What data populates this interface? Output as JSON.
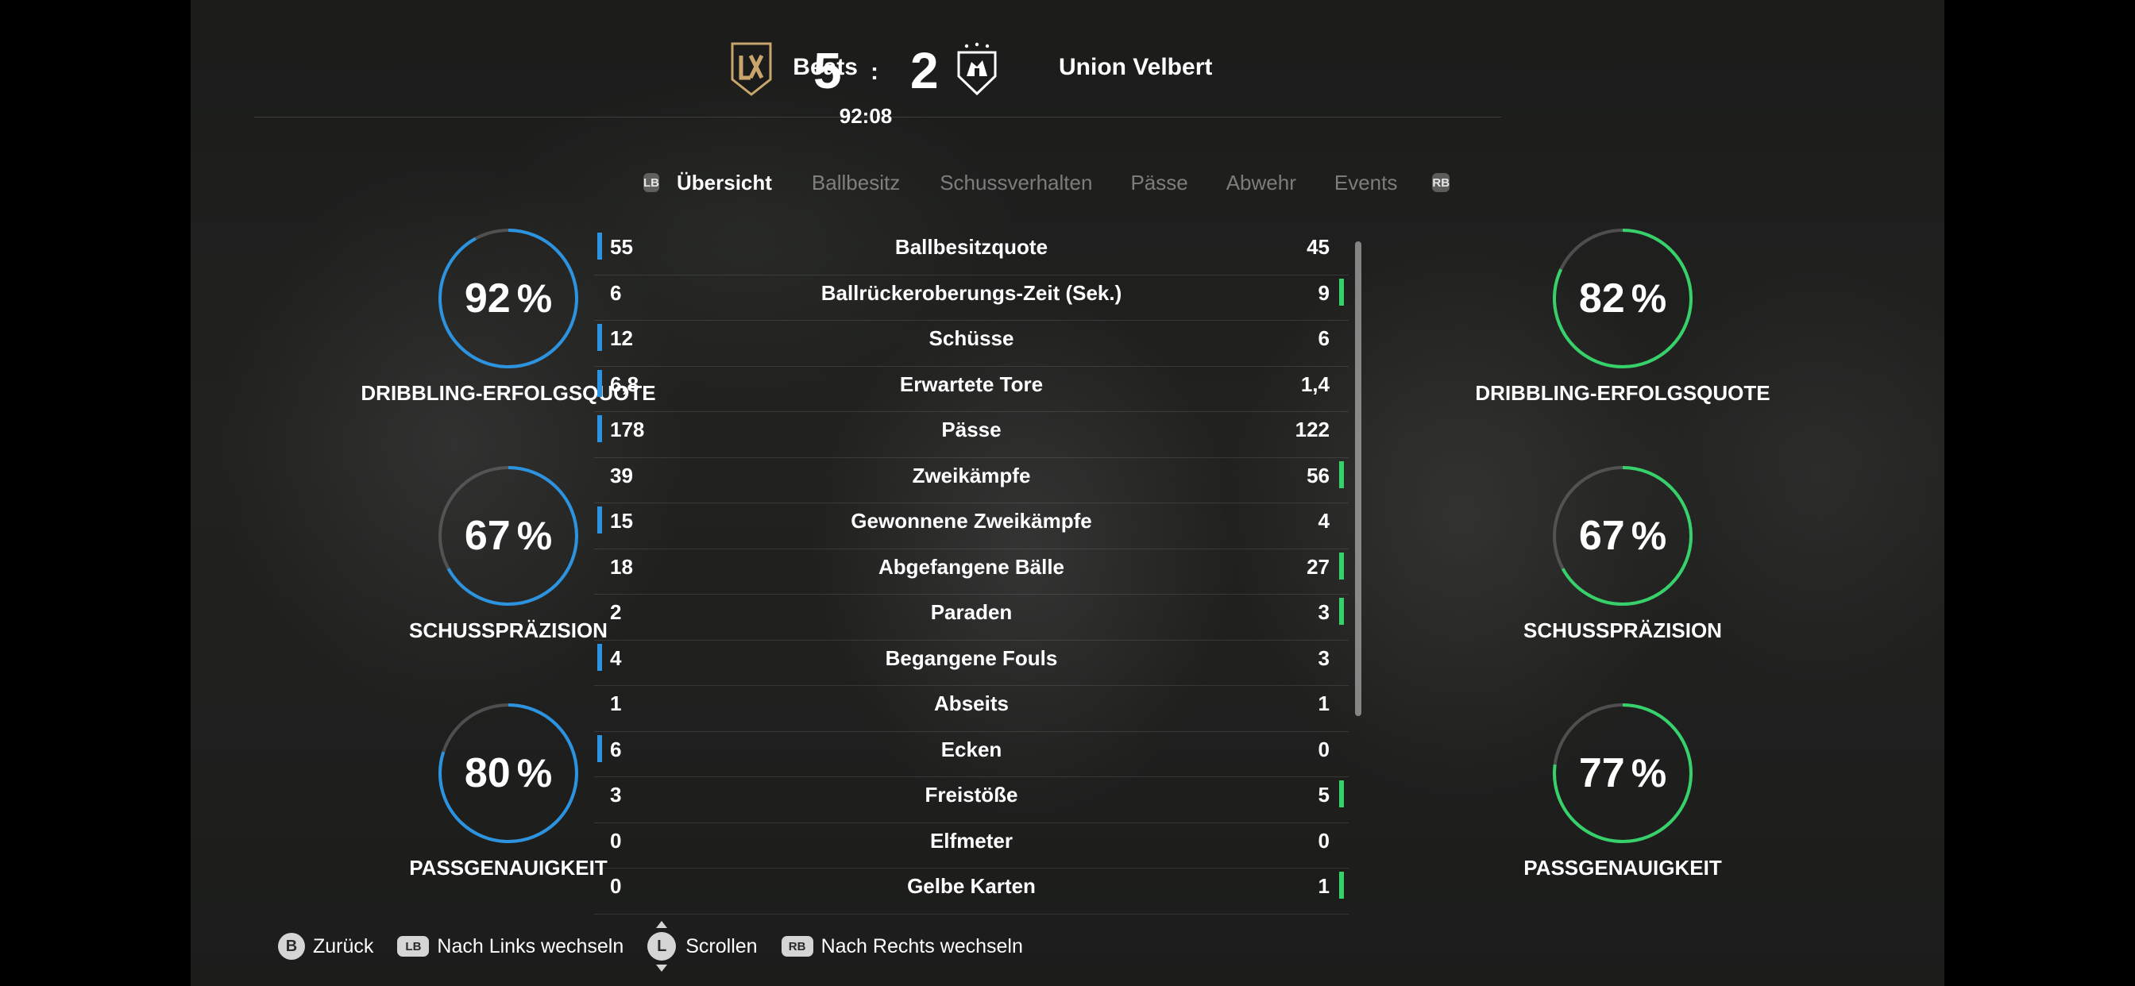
{
  "match": {
    "home_team": "Beats",
    "away_team": "Union Velbert",
    "home_score": "5",
    "score_separator": ":",
    "away_score": "2",
    "clock": "92:08"
  },
  "tabs": {
    "left_shoulder": "LB",
    "right_shoulder": "RB",
    "items": [
      {
        "label": "Übersicht",
        "active": true
      },
      {
        "label": "Ballbesitz",
        "active": false
      },
      {
        "label": "Schussverhalten",
        "active": false
      },
      {
        "label": "Pässe",
        "active": false
      },
      {
        "label": "Abwehr",
        "active": false
      },
      {
        "label": "Events",
        "active": false
      }
    ]
  },
  "home_rings": [
    {
      "value": "92",
      "unit": "%",
      "fraction": 0.92,
      "label": "DRIBBLING-ERFOLGSQUOTE"
    },
    {
      "value": "67",
      "unit": "%",
      "fraction": 0.67,
      "label": "SCHUSSPRÄZISION"
    },
    {
      "value": "80",
      "unit": "%",
      "fraction": 0.8,
      "label": "PASSGENAUIGKEIT"
    }
  ],
  "away_rings": [
    {
      "value": "82",
      "unit": "%",
      "fraction": 0.82,
      "label": "DRIBBLING-ERFOLGSQUOTE"
    },
    {
      "value": "67",
      "unit": "%",
      "fraction": 0.67,
      "label": "SCHUSSPRÄZISION"
    },
    {
      "value": "77",
      "unit": "%",
      "fraction": 0.77,
      "label": "PASSGENAUIGKEIT"
    }
  ],
  "stats": [
    {
      "home": "55",
      "label": "Ballbesitzquote",
      "away": "45",
      "leader": "home"
    },
    {
      "home": "6",
      "label": "Ballrückeroberungs-Zeit (Sek.)",
      "away": "9",
      "leader": "away"
    },
    {
      "home": "12",
      "label": "Schüsse",
      "away": "6",
      "leader": "home"
    },
    {
      "home": "6,8",
      "label": "Erwartete Tore",
      "away": "1,4",
      "leader": "home"
    },
    {
      "home": "178",
      "label": "Pässe",
      "away": "122",
      "leader": "home"
    },
    {
      "home": "39",
      "label": "Zweikämpfe",
      "away": "56",
      "leader": "away"
    },
    {
      "home": "15",
      "label": "Gewonnene Zweikämpfe",
      "away": "4",
      "leader": "home"
    },
    {
      "home": "18",
      "label": "Abgefangene Bälle",
      "away": "27",
      "leader": "away"
    },
    {
      "home": "2",
      "label": "Paraden",
      "away": "3",
      "leader": "away"
    },
    {
      "home": "4",
      "label": "Begangene Fouls",
      "away": "3",
      "leader": "home"
    },
    {
      "home": "1",
      "label": "Abseits",
      "away": "1",
      "leader": "none"
    },
    {
      "home": "6",
      "label": "Ecken",
      "away": "0",
      "leader": "home"
    },
    {
      "home": "3",
      "label": "Freistöße",
      "away": "5",
      "leader": "away"
    },
    {
      "home": "0",
      "label": "Elfmeter",
      "away": "0",
      "leader": "none"
    },
    {
      "home": "0",
      "label": "Gelbe Karten",
      "away": "1",
      "leader": "away"
    }
  ],
  "colors": {
    "home_accent": "#2b93e0",
    "away_accent": "#36d16a"
  },
  "footer": {
    "back_button": "B",
    "back_label": "Zurück",
    "left_button": "LB",
    "left_label": "Nach Links wechseln",
    "scroll_button": "L",
    "scroll_label": "Scrollen",
    "right_button": "RB",
    "right_label": "Nach Rechts wechseln"
  }
}
